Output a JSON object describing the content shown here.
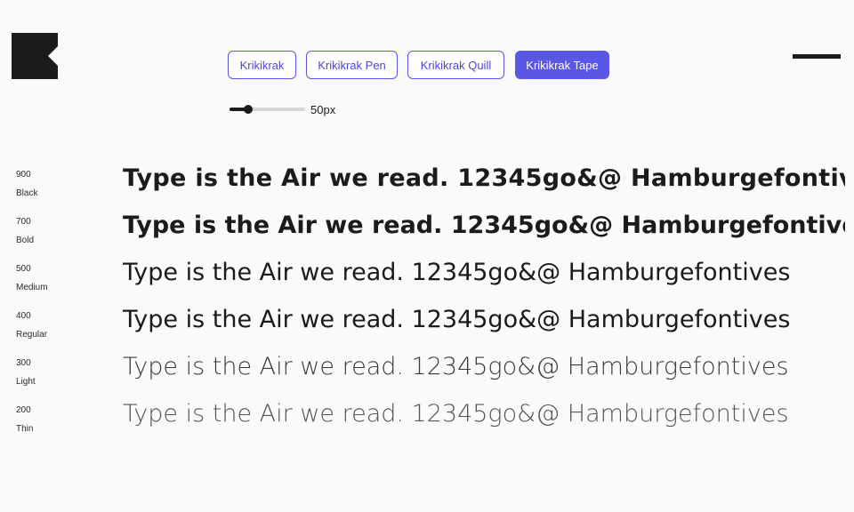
{
  "header": {
    "logo_icon": "krikikrak-k-logo-icon",
    "menu_icon": "hamburger-menu-icon"
  },
  "tabs": [
    {
      "label": "Krikikrak",
      "active": false
    },
    {
      "label": "Krikikrak Pen",
      "active": false
    },
    {
      "label": "Krikikrak Quill",
      "active": false
    },
    {
      "label": "Krikikrak Tape",
      "active": true
    }
  ],
  "size_slider": {
    "value_label": "50px",
    "level_fraction": 0.25
  },
  "sample_text": "Type is the Air we read. 12345go&@ Hamburgefontives",
  "weights": [
    {
      "value": "900",
      "name": "Black"
    },
    {
      "value": "700",
      "name": "Bold"
    },
    {
      "value": "500",
      "name": "Medium"
    },
    {
      "value": "400",
      "name": "Regular"
    },
    {
      "value": "300",
      "name": "Light"
    },
    {
      "value": "200",
      "name": "Thin"
    }
  ],
  "colors": {
    "accent": "#5a56e6",
    "text": "#1b1b1b",
    "background": "#fafafa"
  }
}
